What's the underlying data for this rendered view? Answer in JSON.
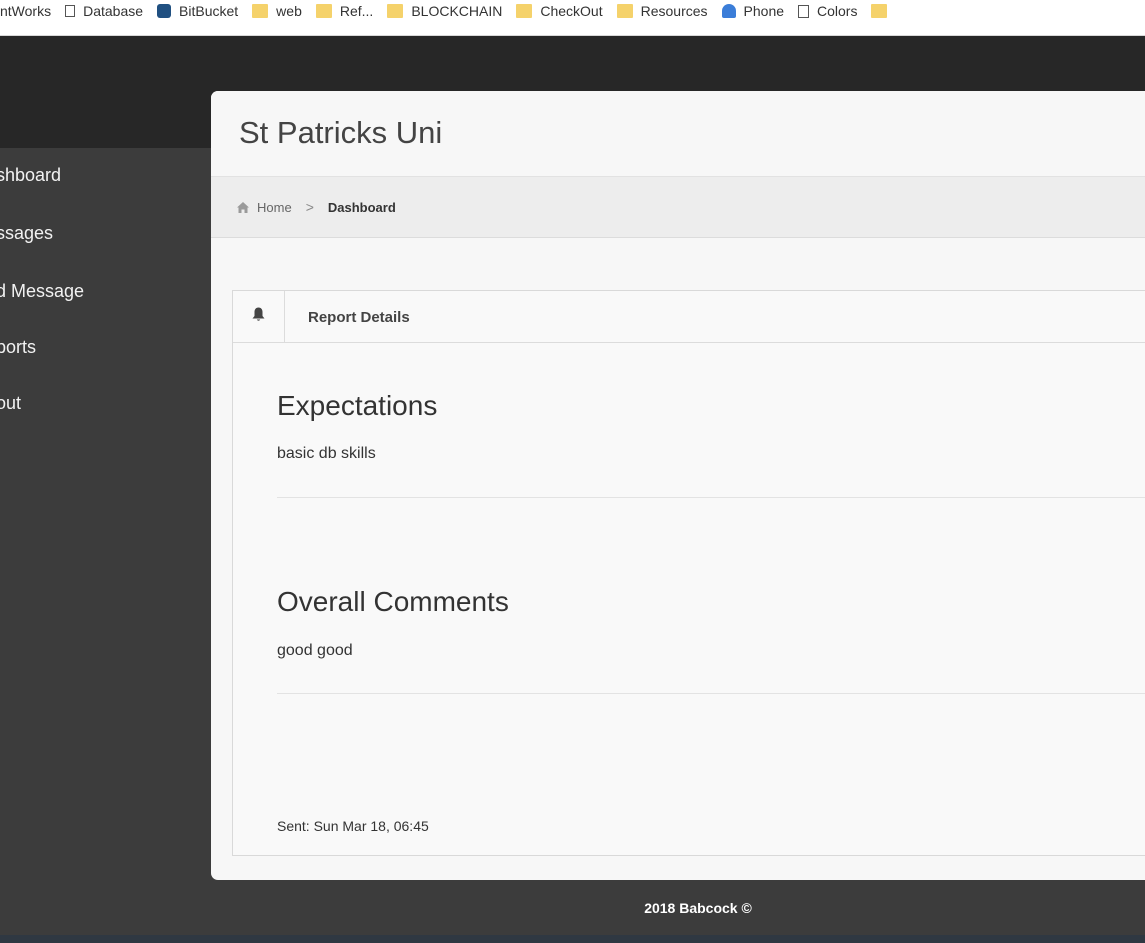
{
  "bookmarks": [
    {
      "label": "ntWorks",
      "icon": "none"
    },
    {
      "label": "Database",
      "icon": "db"
    },
    {
      "label": "BitBucket",
      "icon": "bb"
    },
    {
      "label": "web",
      "icon": "folder"
    },
    {
      "label": "Ref...",
      "icon": "folder"
    },
    {
      "label": "BLOCKCHAIN",
      "icon": "folder"
    },
    {
      "label": "CheckOut",
      "icon": "folder"
    },
    {
      "label": "Resources",
      "icon": "folder"
    },
    {
      "label": "Phone",
      "icon": "person"
    },
    {
      "label": "Colors",
      "icon": "page"
    }
  ],
  "sidebar": {
    "items": [
      {
        "label": "shboard"
      },
      {
        "label": "ssages"
      },
      {
        "label": "d Message"
      },
      {
        "label": "ports"
      },
      {
        "label": "out"
      }
    ]
  },
  "header": {
    "title": "St Patricks Uni"
  },
  "breadcrumb": {
    "home": "Home",
    "separator": ">",
    "current": "Dashboard"
  },
  "report": {
    "title": "Report Details",
    "expectations_heading": "Expectations",
    "expectations_text": "basic db skills",
    "comments_heading": "Overall Comments",
    "comments_text": "good good",
    "sent": "Sent: Sun Mar 18, 06:45"
  },
  "footer": {
    "text": "2018 Babcock ©"
  },
  "colors": {
    "topbar": "#272727",
    "sidebar": "#3c3c3c",
    "panel": "#f7f7f7"
  }
}
